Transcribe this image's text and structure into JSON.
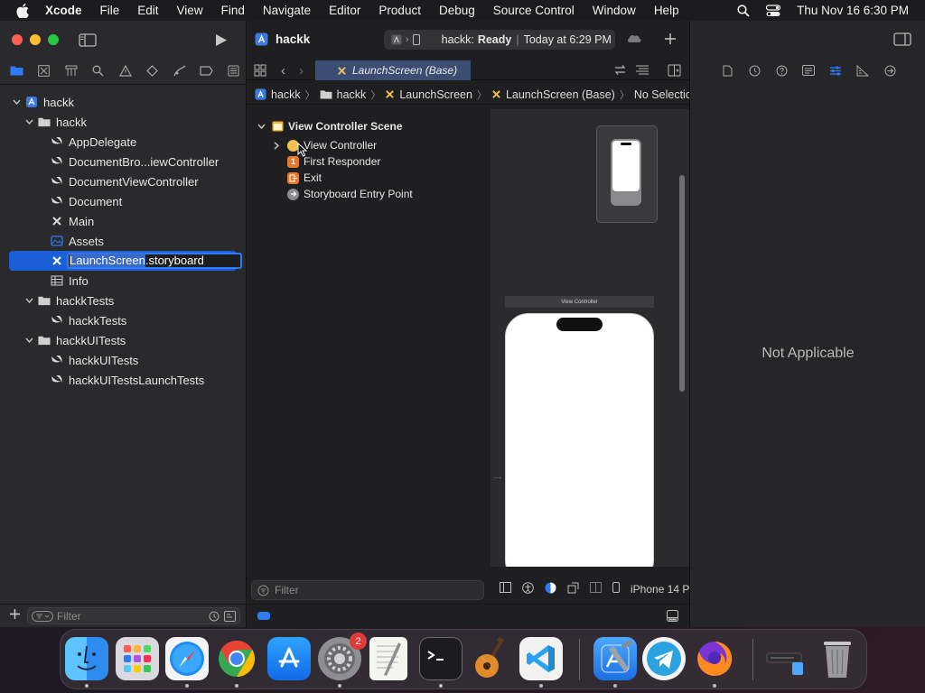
{
  "menubar": {
    "app_name": "Xcode",
    "items": [
      "File",
      "Edit",
      "View",
      "Find",
      "Navigate",
      "Editor",
      "Product",
      "Debug",
      "Source Control",
      "Window",
      "Help"
    ],
    "clock": "Thu Nov 16  6:30 PM"
  },
  "navigator": {
    "tree": [
      {
        "label": "hackk",
        "icon": "project-icon",
        "level": 0,
        "disclosure": "open"
      },
      {
        "label": "hackk",
        "icon": "folder-icon",
        "level": 1,
        "disclosure": "open"
      },
      {
        "label": "AppDelegate",
        "icon": "swift-file-icon",
        "level": 2
      },
      {
        "label": "DocumentBro...iewController",
        "icon": "swift-file-icon",
        "level": 2
      },
      {
        "label": "DocumentViewController",
        "icon": "swift-file-icon",
        "level": 2
      },
      {
        "label": "Document",
        "icon": "swift-file-icon",
        "level": 2
      },
      {
        "label": "Main",
        "icon": "storyboard-icon",
        "level": 2
      },
      {
        "label": "Assets",
        "icon": "assets-icon",
        "level": 2
      },
      {
        "label": "LaunchScreen.storyboard",
        "label_selected_part": "LaunchScreen",
        "label_rest": ".storyboard",
        "icon": "storyboard-icon",
        "level": 2,
        "selected": true,
        "renaming": true
      },
      {
        "label": "Info",
        "icon": "plist-icon",
        "level": 2
      },
      {
        "label": "hackkTests",
        "icon": "folder-icon",
        "level": 1,
        "disclosure": "open"
      },
      {
        "label": "hackkTests",
        "icon": "swift-file-icon",
        "level": 2
      },
      {
        "label": "hackkUITests",
        "icon": "folder-icon",
        "level": 1,
        "disclosure": "open"
      },
      {
        "label": "hackkUITests",
        "icon": "swift-file-icon",
        "level": 2
      },
      {
        "label": "hackkUITestsLaunchTests",
        "icon": "swift-file-icon",
        "level": 2
      }
    ],
    "filter_placeholder": "Filter"
  },
  "editor": {
    "project_title": "hackk",
    "status_scheme": "hackk:",
    "status_state": "Ready",
    "status_time": "Today at 6:29 PM",
    "active_tab": "LaunchScreen (Base)",
    "jumpbar": [
      "hackk",
      "hackk",
      "LaunchScreen",
      "LaunchScreen (Base)",
      "No Selection"
    ],
    "outline": {
      "scene": "View Controller Scene",
      "items": [
        "View Controller",
        "First Responder",
        "Exit",
        "Storyboard Entry Point"
      ]
    },
    "outline_filter_placeholder": "Filter",
    "canvas_scene_label": "View Controller",
    "device_label": "iPhone 14 P"
  },
  "inspector": {
    "message": "Not Applicable"
  },
  "dock": {
    "apps": [
      "Finder",
      "Launchpad",
      "Safari",
      "Chrome",
      "App Store",
      "System Settings",
      "TextEdit",
      "Terminal",
      "GarageBand",
      "Visual Studio Code",
      "Xcode",
      "Telegram",
      "Firefox",
      "Downloads",
      "Trash"
    ],
    "settings_badge": "2"
  },
  "colors": {
    "accent": "#1a5fd6",
    "close": "#ff5f57",
    "minimize": "#febc2e",
    "zoom": "#28c840"
  }
}
